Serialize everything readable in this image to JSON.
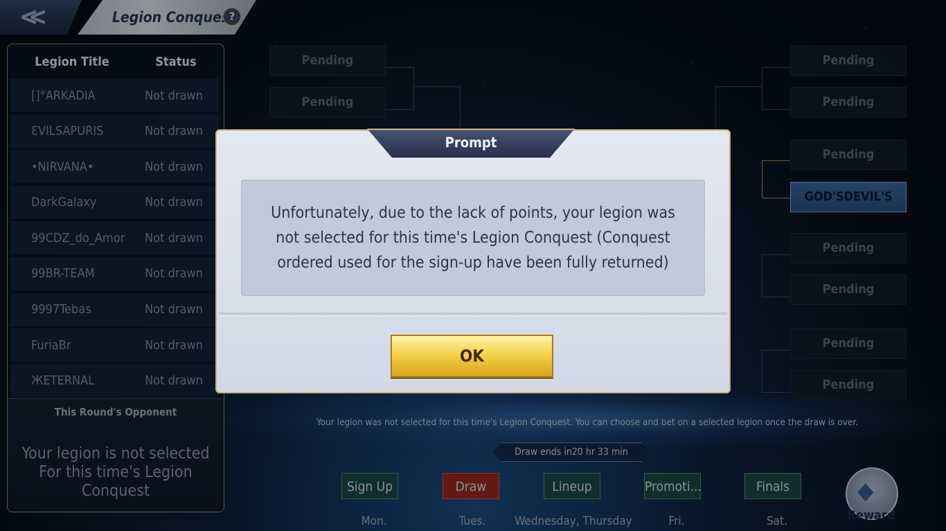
{
  "header": {
    "title": "Legion Conquest",
    "help": "?"
  },
  "left_panel": {
    "col_title": "Legion Title",
    "col_status": "Status",
    "rows": [
      {
        "name": "[]°ARKADIA",
        "status": "Not drawn"
      },
      {
        "name": "ƐVILSAPURIS",
        "status": "Not drawn"
      },
      {
        "name": "•NIRVANA•",
        "status": "Not drawn"
      },
      {
        "name": "DarkGalaxy",
        "status": "Not drawn"
      },
      {
        "name": "99CDZ_do_Amor",
        "status": "Not drawn"
      },
      {
        "name": "99BR-TEAM",
        "status": "Not drawn"
      },
      {
        "name": "9997Tebas",
        "status": "Not drawn"
      },
      {
        "name": "FuriaBr",
        "status": "Not drawn"
      },
      {
        "name": "ЖETERNAL",
        "status": "Not drawn"
      }
    ],
    "opponent_title": "This Round's Opponent",
    "opponent_line1": "Your legion is not selected",
    "opponent_line2": "For this time's Legion Conquest"
  },
  "bracket": {
    "left": [
      "Pending",
      "Pending"
    ],
    "right": [
      "Pending",
      "Pending",
      "Pending",
      "GOD'SDEVIL'S",
      "Pending",
      "Pending",
      "Pending",
      "Pending"
    ]
  },
  "notice": "Your legion was not selected for this time's Legion Conquest. You can choose and bet on a selected legion once the draw is over.",
  "timer": "Draw ends in20 hr 33 min",
  "stages": [
    {
      "label": "Sign Up",
      "day": "Mon."
    },
    {
      "label": "Draw",
      "day": "Tues."
    },
    {
      "label": "Lineup",
      "day": "Wednesday, Thursday"
    },
    {
      "label": "Promoti...",
      "day": "Fri."
    },
    {
      "label": "Finals",
      "day": "Sat."
    }
  ],
  "reward_label": "Reward",
  "modal": {
    "title": "Prompt",
    "message_line1": "Unfortunately, due to the lack of points, your legion was",
    "message_line2": "not selected for this time's Legion Conquest (Conquest",
    "message_line3": "ordered used for the sign-up have been fully returned)",
    "ok_label": "OK"
  },
  "colors": {
    "gold": "#c8b07a",
    "active_stage": "#a02a22",
    "stage": "#1e4b48",
    "ok_button": "#f3cf45"
  }
}
